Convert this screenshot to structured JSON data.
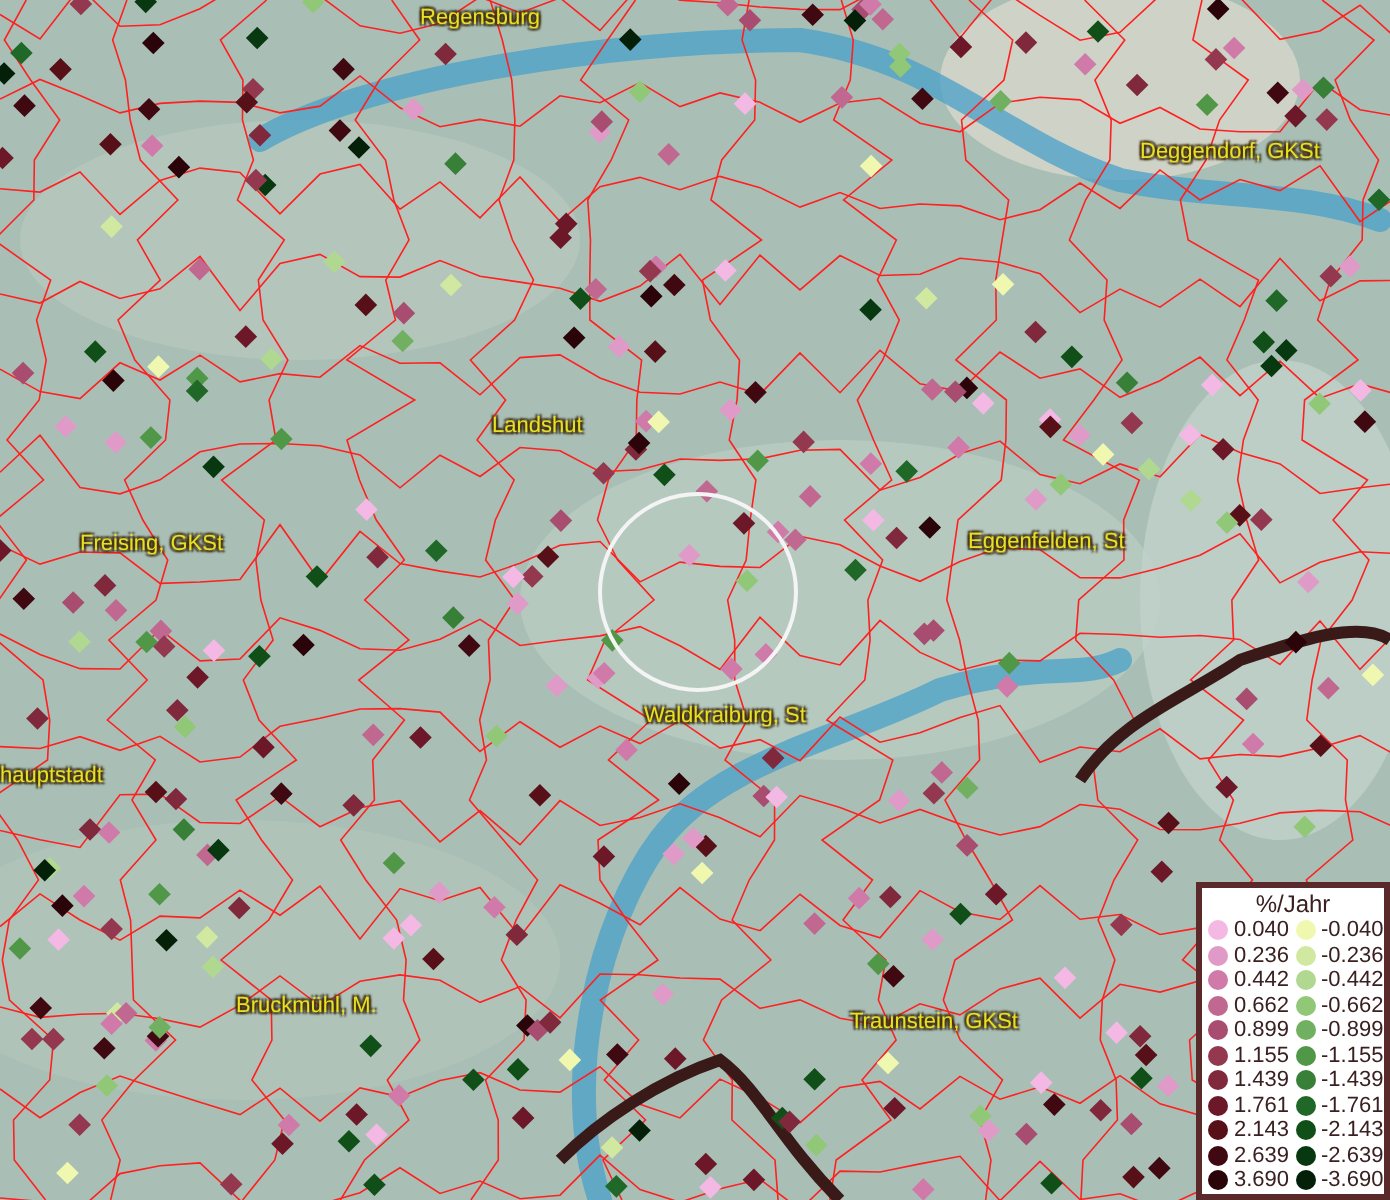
{
  "map": {
    "place_labels": [
      {
        "text": "Regensburg"
      },
      {
        "text": "Deggendorf, GKSt"
      },
      {
        "text": "Landshut"
      },
      {
        "text": "Freising, GKSt"
      },
      {
        "text": "Eggenfelden, St"
      },
      {
        "text": "Waldkraiburg, St"
      },
      {
        "text": "hauptstadt"
      },
      {
        "text": "Bruckmühl, M."
      },
      {
        "text": "Traunstein, GKSt"
      }
    ],
    "legend": {
      "title": "%/Jahr",
      "increase": [
        {
          "label": "0.040",
          "color": "#f4b8e4"
        },
        {
          "label": "0.236",
          "color": "#e09ac8"
        },
        {
          "label": "0.442",
          "color": "#cf7aa8"
        },
        {
          "label": "0.662",
          "color": "#c06890"
        },
        {
          "label": "0.899",
          "color": "#a84c70"
        },
        {
          "label": "1.155",
          "color": "#94384f"
        },
        {
          "label": "1.439",
          "color": "#80283c"
        },
        {
          "label": "1.761",
          "color": "#6c1828"
        },
        {
          "label": "2.143",
          "color": "#581018"
        },
        {
          "label": "2.639",
          "color": "#400810"
        },
        {
          "label": "3.690",
          "color": "#2a0408"
        }
      ],
      "decrease": [
        {
          "label": "-0.040",
          "color": "#f0f8b0"
        },
        {
          "label": "-0.236",
          "color": "#d0e8a0"
        },
        {
          "label": "-0.442",
          "color": "#b0d890"
        },
        {
          "label": "-0.662",
          "color": "#90c878"
        },
        {
          "label": "-0.899",
          "color": "#70b060"
        },
        {
          "label": "-1.155",
          "color": "#509848"
        },
        {
          "label": "-1.439",
          "color": "#388038"
        },
        {
          "label": "-1.761",
          "color": "#206828"
        },
        {
          "label": "-2.143",
          "color": "#105018"
        },
        {
          "label": "-2.639",
          "color": "#083810"
        },
        {
          "label": "-3.690",
          "color": "#042008"
        }
      ]
    }
  }
}
